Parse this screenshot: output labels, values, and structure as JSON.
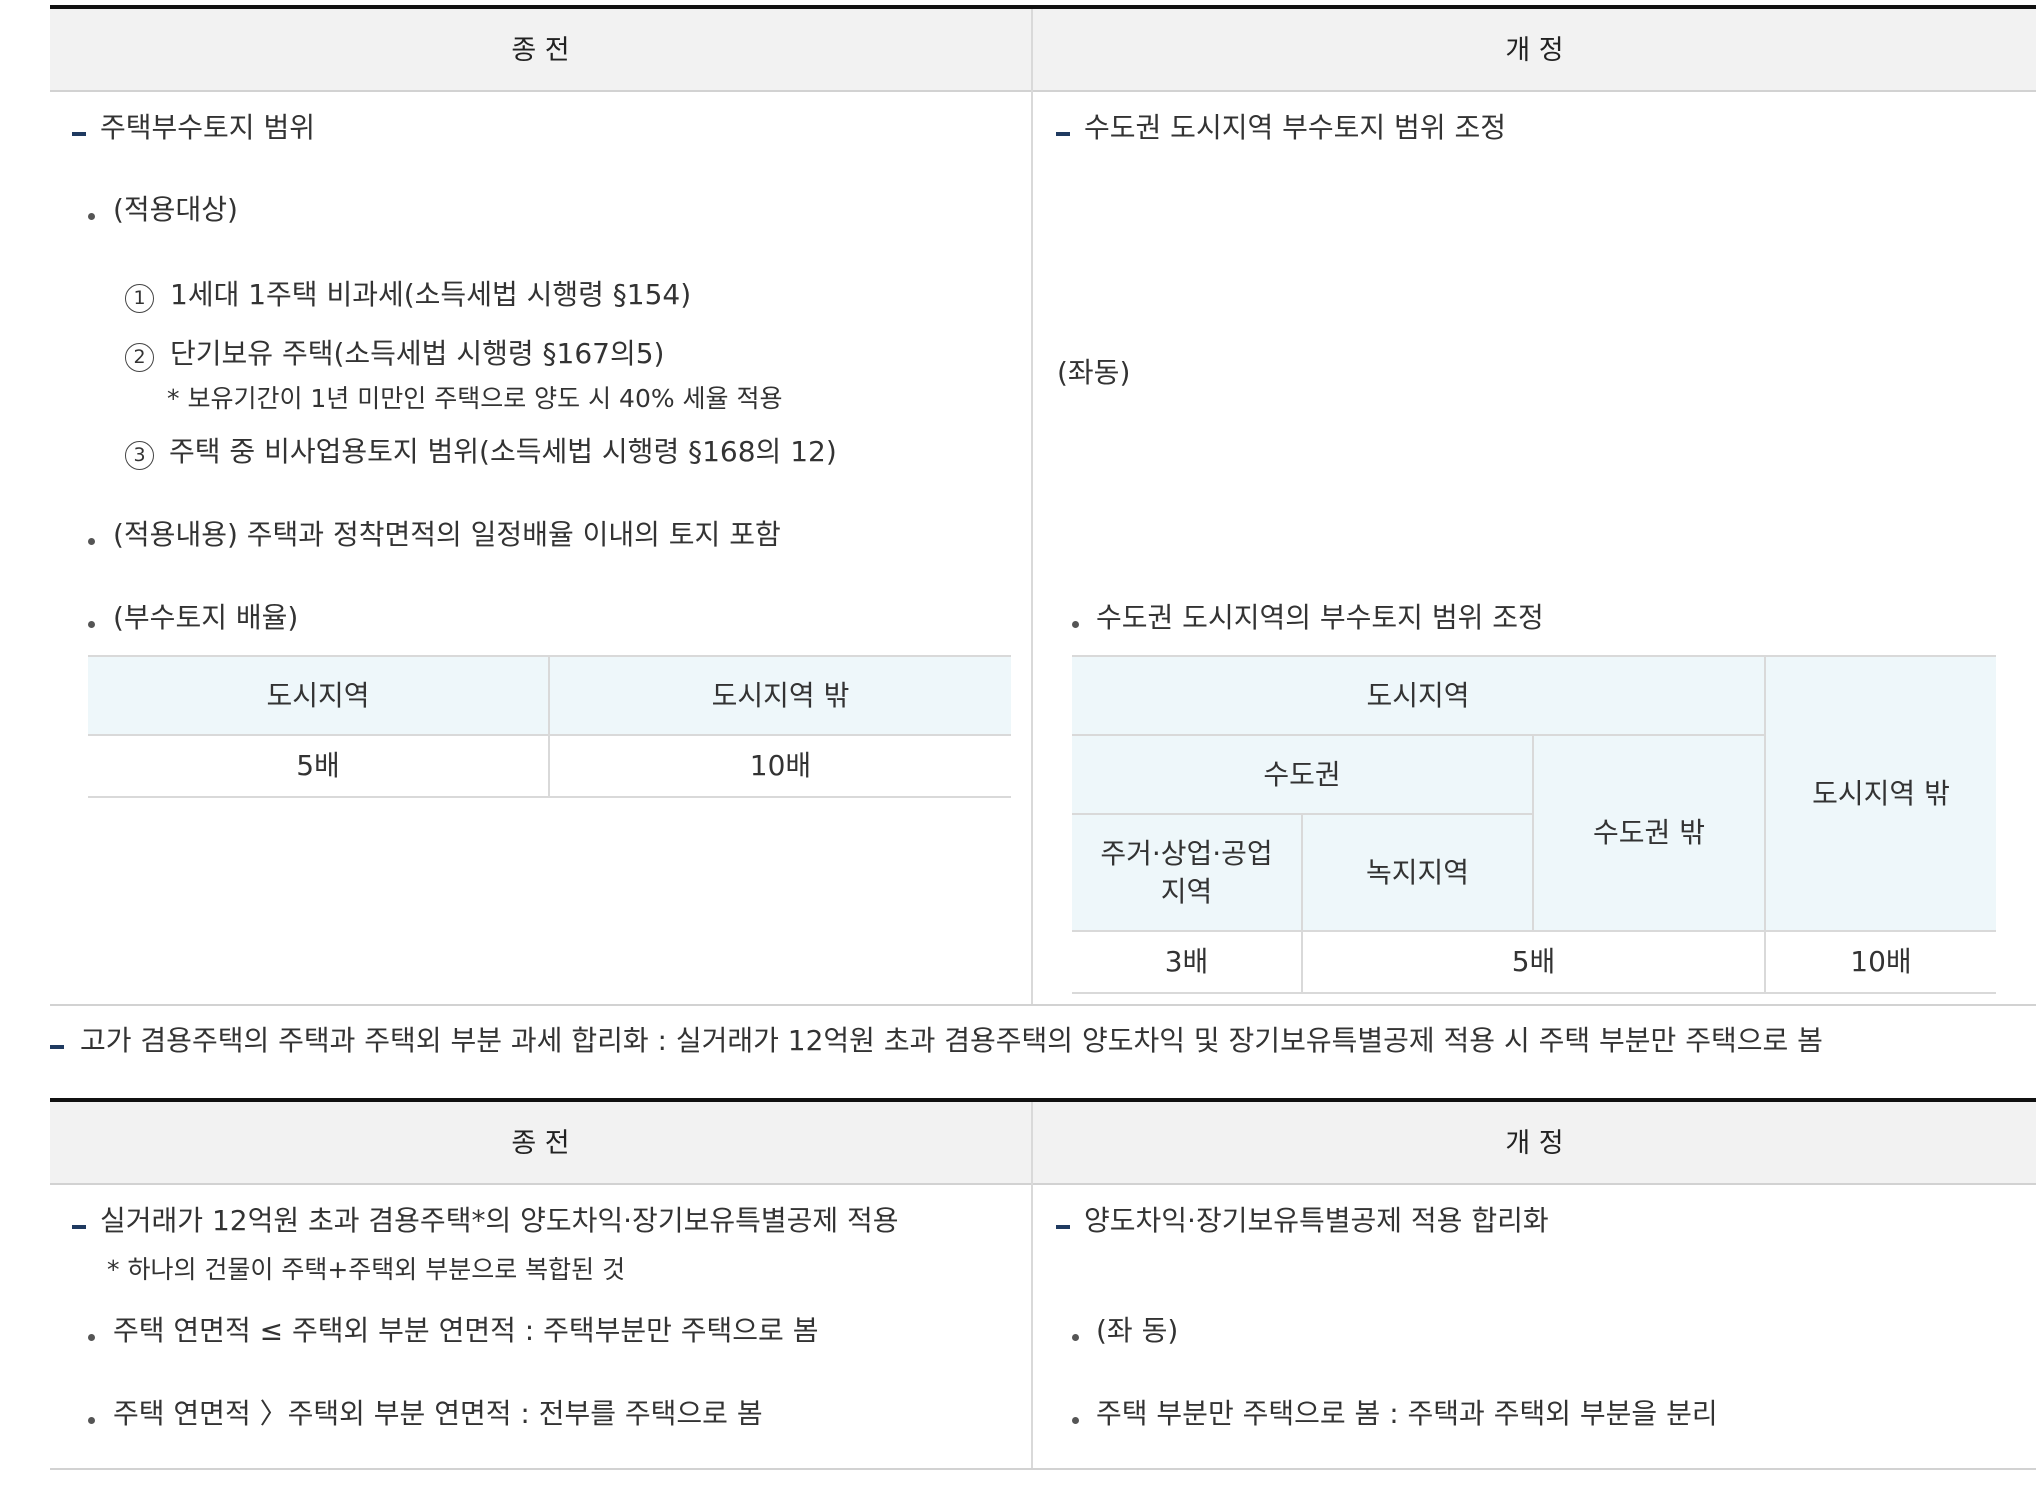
{
  "section1": {
    "header_before": "종 전",
    "header_after": "개 정",
    "left": {
      "title": "주택부수토지 범위",
      "bullet_target": "(적용대상)",
      "items": [
        {
          "num": "1",
          "text": "1세대 1주택 비과세(소득세법 시행령 §154)"
        },
        {
          "num": "2",
          "text": "단기보유 주택(소득세법 시행령 §167의5)"
        },
        {
          "num": "3",
          "text": "주택 중 비사업용토지 범위(소득세법 시행령 §168의 12)"
        }
      ],
      "note": "* 보유기간이 1년 미만인 주택으로 양도 시 40% 세율 적용",
      "bullet_content": "(적용내용) 주택과 정착면적의 일정배율 이내의 토지 포함",
      "bullet_ratio": "(부수토지 배율)",
      "ratio_table": {
        "headers": [
          "도시지역",
          "도시지역 밖"
        ],
        "values": [
          "5배",
          "10배"
        ]
      }
    },
    "right": {
      "title": "수도권 도시지역 부수토지 범위 조정",
      "same": "(좌동)",
      "bullet": "수도권 도시지역의 부수토지 범위 조정",
      "ratio_table": {
        "urban": "도시지역",
        "capital": "수도권",
        "outside_urban": "도시지역 밖",
        "outside_capital": "수도권 밖",
        "residential": "주거·상업·공업 지역",
        "green": "녹지지역",
        "values": [
          "3배",
          "5배",
          "10배"
        ]
      }
    }
  },
  "section2": {
    "title": "고가 겸용주택의 주택과 주택외 부분 과세 합리화 : 실거래가 12억원 초과 겸용주택의 양도차익 및 장기보유특별공제 적용 시 주택 부분만 주택으로 봄",
    "header_before": "종 전",
    "header_after": "개 정",
    "left": {
      "title": "실거래가 12억원 초과 겸용주택*의 양도차익·장기보유특별공제 적용",
      "note": "* 하나의 건물이 주택+주택외 부분으로 복합된 것",
      "bullet1": "주택 연면적 ≤ 주택외 부분 연면적 : 주택부분만 주택으로 봄",
      "bullet2": "주택 연면적 〉주택외 부분 연면적 : 전부를 주택으로 봄"
    },
    "right": {
      "title": "양도차익·장기보유특별공제 적용 합리화",
      "bullet1": "(좌 동)",
      "bullet2": "주택 부분만 주택으로 봄 : 주택과 주택외 부분을 분리"
    }
  }
}
